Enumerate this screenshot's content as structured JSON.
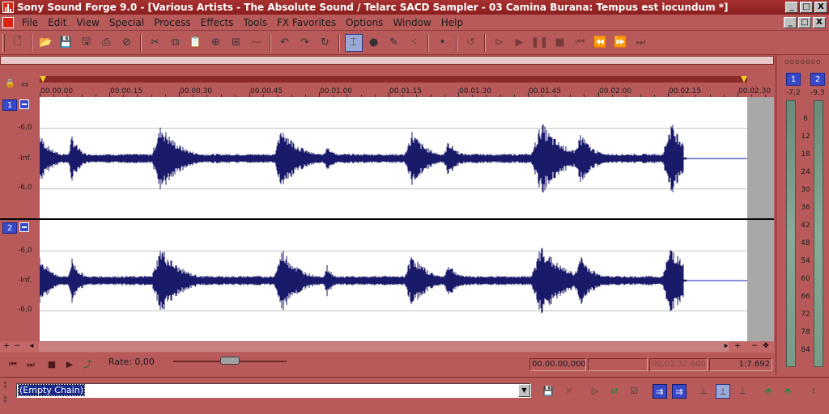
{
  "window": {
    "title": "Sony Sound Forge 9.0 - [Various Artists - The Absolute Sound / Telarc SACD Sampler - 03 Camina Burana: Tempus est iocundum *]",
    "controls": [
      "_",
      "□",
      "X"
    ],
    "doc_controls": [
      "_",
      "□",
      "X"
    ]
  },
  "menu": [
    "File",
    "Edit",
    "View",
    "Special",
    "Process",
    "Effects",
    "Tools",
    "FX Favorites",
    "Options",
    "Window",
    "Help"
  ],
  "toolbar": {
    "icons": [
      "new-file-icon",
      "open-folder-icon",
      "save-icon",
      "save-as-icon",
      "print-icon",
      "properties-icon",
      "cut-icon",
      "copy-icon",
      "paste-icon",
      "paste-special-icon",
      "mix-icon",
      "trim-icon",
      "undo-icon",
      "redo-icon",
      "repeat-icon",
      "edit-tool-icon",
      "magnify-tool-icon",
      "pencil-tool-icon",
      "envelope-tool-icon",
      "record-icon",
      "loop-icon",
      "play-all-icon",
      "play-icon",
      "pause-icon",
      "stop-icon",
      "go-to-start-icon",
      "rewind-icon",
      "forward-icon",
      "go-to-end-icon"
    ]
  },
  "ruler": {
    "labels": [
      "00.00.00",
      "00.00.15",
      "00.00.30",
      "00.00.45",
      "00.01.00",
      "00.01.15",
      "00.01.30",
      "00.01.45",
      "00.02.00",
      "00.02.15",
      "00.02.30"
    ]
  },
  "channels": [
    {
      "number": "1",
      "db_labels": [
        "-6,0",
        "-Inf.",
        "-6,0"
      ]
    },
    {
      "number": "2",
      "db_labels": [
        "-6,0",
        "-Inf.",
        "-6,0"
      ]
    }
  ],
  "transport": {
    "rate_label": "Rate: 0,00",
    "position": "00.00.00,000",
    "length": "00.02.32,600",
    "zoom": "1:7.692"
  },
  "meters": {
    "top_label": "ooooooo",
    "channels": [
      "1",
      "2"
    ],
    "peaks": [
      "-7,2",
      "-9,3"
    ],
    "scale": [
      "6",
      "12",
      "18",
      "24",
      "30",
      "36",
      "42",
      "48",
      "54",
      "60",
      "66",
      "72",
      "78",
      "84"
    ]
  },
  "plugin_chain": {
    "value": "(Empty Chain)"
  },
  "colors": {
    "chrome": "#b85a5a",
    "titlebar": "#a83232",
    "waveform": "#1a1a6a",
    "channel_badge": "#3848c8"
  }
}
